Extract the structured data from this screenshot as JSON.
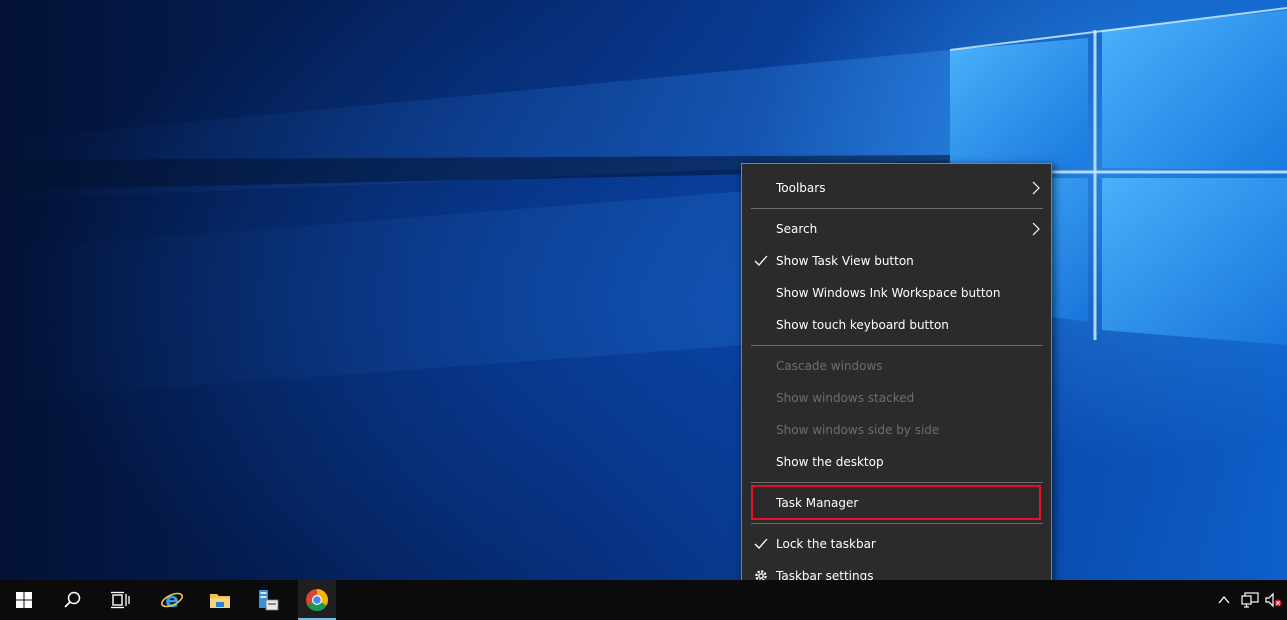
{
  "context_menu": {
    "items": [
      {
        "label": "Toolbars",
        "checked": false,
        "submenu": true,
        "enabled": true
      },
      {
        "label": "Search",
        "checked": false,
        "submenu": true,
        "enabled": true
      },
      {
        "label": "Show Task View button",
        "checked": true,
        "submenu": false,
        "enabled": true
      },
      {
        "label": "Show Windows Ink Workspace button",
        "checked": false,
        "submenu": false,
        "enabled": true
      },
      {
        "label": "Show touch keyboard button",
        "checked": false,
        "submenu": false,
        "enabled": true
      },
      {
        "label": "Cascade windows",
        "checked": false,
        "submenu": false,
        "enabled": false
      },
      {
        "label": "Show windows stacked",
        "checked": false,
        "submenu": false,
        "enabled": false
      },
      {
        "label": "Show windows side by side",
        "checked": false,
        "submenu": false,
        "enabled": false
      },
      {
        "label": "Show the desktop",
        "checked": false,
        "submenu": false,
        "enabled": true
      },
      {
        "label": "Task Manager",
        "checked": false,
        "submenu": false,
        "enabled": true,
        "highlighted": true
      },
      {
        "label": "Lock the taskbar",
        "checked": true,
        "submenu": false,
        "enabled": true
      },
      {
        "label": "Taskbar settings",
        "checked": false,
        "submenu": false,
        "enabled": true,
        "icon": "gear-icon"
      }
    ]
  },
  "taskbar": {
    "buttons": [
      {
        "name": "start-button",
        "icon": "windows-logo-icon"
      },
      {
        "name": "search-button",
        "icon": "search-icon"
      },
      {
        "name": "task-view-button",
        "icon": "task-view-icon"
      },
      {
        "name": "edge-button",
        "icon": "internet-explorer-icon"
      },
      {
        "name": "file-explorer-button",
        "icon": "folder-icon"
      },
      {
        "name": "server-manager-button",
        "icon": "server-manager-icon"
      },
      {
        "name": "chrome-button",
        "icon": "chrome-icon",
        "active": true
      }
    ],
    "tray": [
      {
        "name": "show-hidden-icons",
        "icon": "chevron-up-icon"
      },
      {
        "name": "network-status",
        "icon": "network-icon"
      },
      {
        "name": "volume-status",
        "icon": "volume-muted-icon"
      }
    ]
  },
  "colors": {
    "menu_background": "#2b2b2b",
    "menu_border": "#808080",
    "disabled_text": "#6d6d6d",
    "highlight_border": "#e81123",
    "taskbar_background": "#0b0b0b",
    "accent": "#76b9ed"
  }
}
